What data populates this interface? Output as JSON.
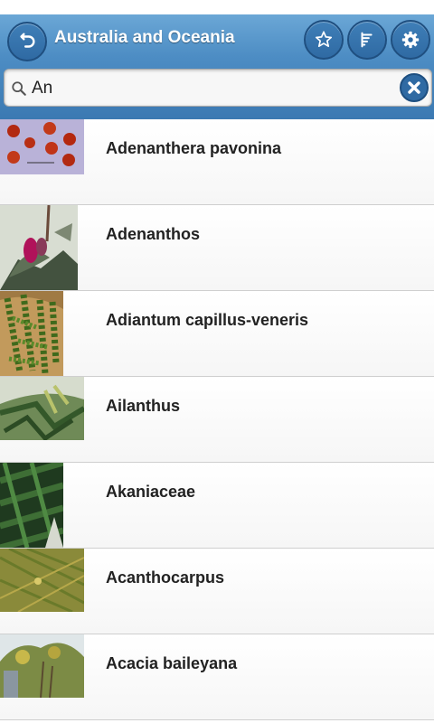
{
  "header": {
    "title": "Australia and Oceania",
    "buttons": [
      "back-icon",
      "star-icon",
      "sort-icon",
      "gear-icon"
    ]
  },
  "search": {
    "value": "An",
    "placeholder": ""
  },
  "plants": [
    {
      "name": "Adenanthera pavonina"
    },
    {
      "name": "Adenanthos"
    },
    {
      "name": "Adiantum capillus-veneris"
    },
    {
      "name": "Ailanthus"
    },
    {
      "name": "Akaniaceae"
    },
    {
      "name": "Acanthocarpus"
    },
    {
      "name": "Acacia baileyana"
    }
  ],
  "colors": {
    "header": "#4d8dc4",
    "button": "#2f6aa3",
    "text": "#222222"
  }
}
